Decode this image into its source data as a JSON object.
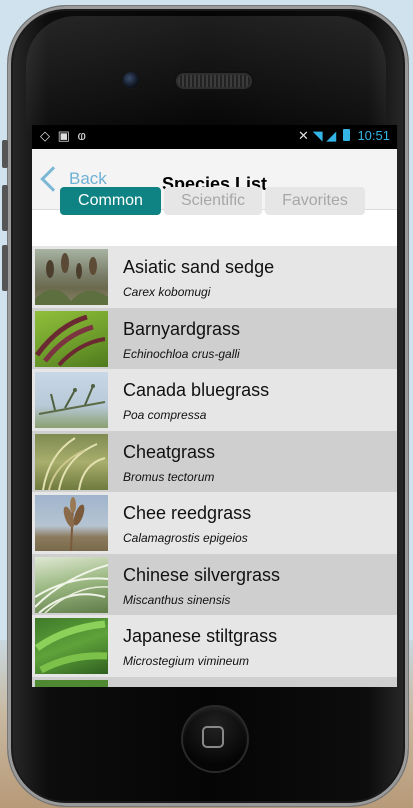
{
  "status_bar": {
    "left_icons": [
      "notification-icon",
      "image-icon",
      "usb-icon"
    ],
    "right_icons": [
      "mute-icon",
      "wifi-icon",
      "signal-icon",
      "battery-icon"
    ],
    "time": "10:51"
  },
  "nav": {
    "back_label": "Back",
    "title": "Species List"
  },
  "tabs": [
    {
      "label": "Common",
      "active": true
    },
    {
      "label": "Scientific",
      "active": false
    },
    {
      "label": "Favorites",
      "active": false
    }
  ],
  "species": [
    {
      "common": "Asiatic sand sedge",
      "scientific": "Carex kobomugi"
    },
    {
      "common": "Barnyardgrass",
      "scientific": "Echinochloa crus-galli"
    },
    {
      "common": "Canada bluegrass",
      "scientific": "Poa compressa"
    },
    {
      "common": "Cheatgrass",
      "scientific": "Bromus tectorum"
    },
    {
      "common": "Chee reedgrass",
      "scientific": "Calamagrostis epigeios"
    },
    {
      "common": "Chinese silvergrass",
      "scientific": "Miscanthus sinensis"
    },
    {
      "common": "Japanese stiltgrass",
      "scientific": "Microstegium vimineum"
    }
  ],
  "colors": {
    "accent": "#0f8383",
    "back_link": "#6fb1d4",
    "status_icons": "#33b5e5"
  }
}
